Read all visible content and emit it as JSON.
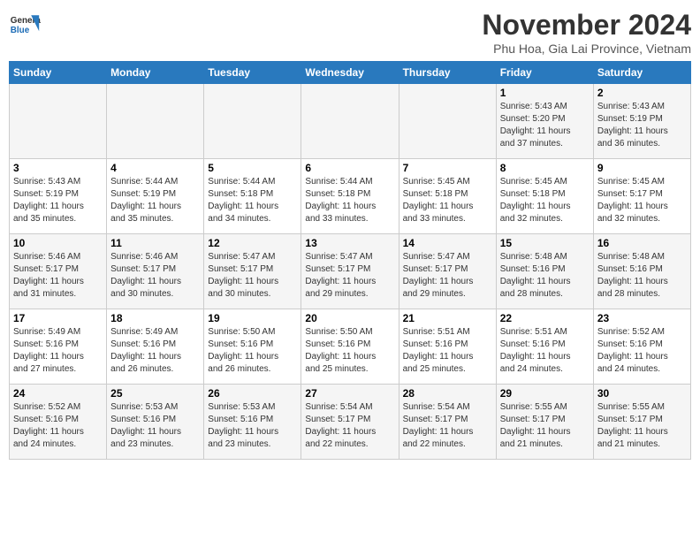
{
  "header": {
    "logo_general": "General",
    "logo_blue": "Blue",
    "month_year": "November 2024",
    "location": "Phu Hoa, Gia Lai Province, Vietnam"
  },
  "days_of_week": [
    "Sunday",
    "Monday",
    "Tuesday",
    "Wednesday",
    "Thursday",
    "Friday",
    "Saturday"
  ],
  "weeks": [
    {
      "days": [
        {
          "date": "",
          "info": ""
        },
        {
          "date": "",
          "info": ""
        },
        {
          "date": "",
          "info": ""
        },
        {
          "date": "",
          "info": ""
        },
        {
          "date": "",
          "info": ""
        },
        {
          "date": "1",
          "info": "Sunrise: 5:43 AM\nSunset: 5:20 PM\nDaylight: 11 hours\nand 37 minutes."
        },
        {
          "date": "2",
          "info": "Sunrise: 5:43 AM\nSunset: 5:19 PM\nDaylight: 11 hours\nand 36 minutes."
        }
      ]
    },
    {
      "days": [
        {
          "date": "3",
          "info": "Sunrise: 5:43 AM\nSunset: 5:19 PM\nDaylight: 11 hours\nand 35 minutes."
        },
        {
          "date": "4",
          "info": "Sunrise: 5:44 AM\nSunset: 5:19 PM\nDaylight: 11 hours\nand 35 minutes."
        },
        {
          "date": "5",
          "info": "Sunrise: 5:44 AM\nSunset: 5:18 PM\nDaylight: 11 hours\nand 34 minutes."
        },
        {
          "date": "6",
          "info": "Sunrise: 5:44 AM\nSunset: 5:18 PM\nDaylight: 11 hours\nand 33 minutes."
        },
        {
          "date": "7",
          "info": "Sunrise: 5:45 AM\nSunset: 5:18 PM\nDaylight: 11 hours\nand 33 minutes."
        },
        {
          "date": "8",
          "info": "Sunrise: 5:45 AM\nSunset: 5:18 PM\nDaylight: 11 hours\nand 32 minutes."
        },
        {
          "date": "9",
          "info": "Sunrise: 5:45 AM\nSunset: 5:17 PM\nDaylight: 11 hours\nand 32 minutes."
        }
      ]
    },
    {
      "days": [
        {
          "date": "10",
          "info": "Sunrise: 5:46 AM\nSunset: 5:17 PM\nDaylight: 11 hours\nand 31 minutes."
        },
        {
          "date": "11",
          "info": "Sunrise: 5:46 AM\nSunset: 5:17 PM\nDaylight: 11 hours\nand 30 minutes."
        },
        {
          "date": "12",
          "info": "Sunrise: 5:47 AM\nSunset: 5:17 PM\nDaylight: 11 hours\nand 30 minutes."
        },
        {
          "date": "13",
          "info": "Sunrise: 5:47 AM\nSunset: 5:17 PM\nDaylight: 11 hours\nand 29 minutes."
        },
        {
          "date": "14",
          "info": "Sunrise: 5:47 AM\nSunset: 5:17 PM\nDaylight: 11 hours\nand 29 minutes."
        },
        {
          "date": "15",
          "info": "Sunrise: 5:48 AM\nSunset: 5:16 PM\nDaylight: 11 hours\nand 28 minutes."
        },
        {
          "date": "16",
          "info": "Sunrise: 5:48 AM\nSunset: 5:16 PM\nDaylight: 11 hours\nand 28 minutes."
        }
      ]
    },
    {
      "days": [
        {
          "date": "17",
          "info": "Sunrise: 5:49 AM\nSunset: 5:16 PM\nDaylight: 11 hours\nand 27 minutes."
        },
        {
          "date": "18",
          "info": "Sunrise: 5:49 AM\nSunset: 5:16 PM\nDaylight: 11 hours\nand 26 minutes."
        },
        {
          "date": "19",
          "info": "Sunrise: 5:50 AM\nSunset: 5:16 PM\nDaylight: 11 hours\nand 26 minutes."
        },
        {
          "date": "20",
          "info": "Sunrise: 5:50 AM\nSunset: 5:16 PM\nDaylight: 11 hours\nand 25 minutes."
        },
        {
          "date": "21",
          "info": "Sunrise: 5:51 AM\nSunset: 5:16 PM\nDaylight: 11 hours\nand 25 minutes."
        },
        {
          "date": "22",
          "info": "Sunrise: 5:51 AM\nSunset: 5:16 PM\nDaylight: 11 hours\nand 24 minutes."
        },
        {
          "date": "23",
          "info": "Sunrise: 5:52 AM\nSunset: 5:16 PM\nDaylight: 11 hours\nand 24 minutes."
        }
      ]
    },
    {
      "days": [
        {
          "date": "24",
          "info": "Sunrise: 5:52 AM\nSunset: 5:16 PM\nDaylight: 11 hours\nand 24 minutes."
        },
        {
          "date": "25",
          "info": "Sunrise: 5:53 AM\nSunset: 5:16 PM\nDaylight: 11 hours\nand 23 minutes."
        },
        {
          "date": "26",
          "info": "Sunrise: 5:53 AM\nSunset: 5:16 PM\nDaylight: 11 hours\nand 23 minutes."
        },
        {
          "date": "27",
          "info": "Sunrise: 5:54 AM\nSunset: 5:17 PM\nDaylight: 11 hours\nand 22 minutes."
        },
        {
          "date": "28",
          "info": "Sunrise: 5:54 AM\nSunset: 5:17 PM\nDaylight: 11 hours\nand 22 minutes."
        },
        {
          "date": "29",
          "info": "Sunrise: 5:55 AM\nSunset: 5:17 PM\nDaylight: 11 hours\nand 21 minutes."
        },
        {
          "date": "30",
          "info": "Sunrise: 5:55 AM\nSunset: 5:17 PM\nDaylight: 11 hours\nand 21 minutes."
        }
      ]
    }
  ]
}
